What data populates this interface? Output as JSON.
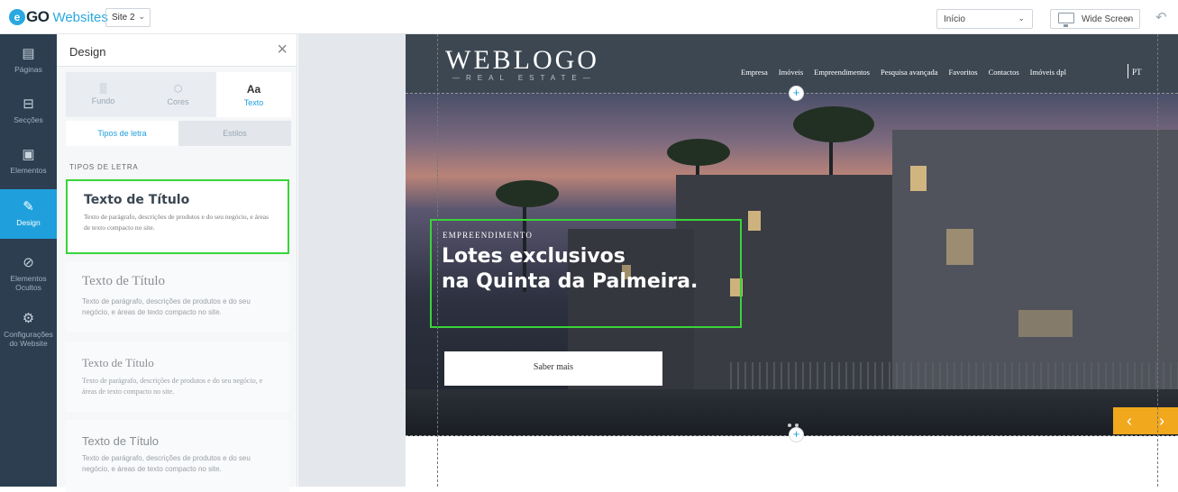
{
  "topbar": {
    "logo_mark": "e",
    "logo_go": "GO",
    "logo_web": "Websites",
    "site_value": "Site 2",
    "page_value": "Início",
    "screen_value": "Wide Screen"
  },
  "leftnav": {
    "items": [
      {
        "label": "Páginas",
        "icon": "pages-icon"
      },
      {
        "label": "Secções",
        "icon": "sections-icon"
      },
      {
        "label": "Elementos",
        "icon": "elements-icon"
      },
      {
        "label": "Design",
        "icon": "pencil-icon"
      },
      {
        "label": "Elementos Ocultos",
        "icon": "eye-slash-icon"
      },
      {
        "label": "Configurações do Website",
        "icon": "gear-icon"
      }
    ]
  },
  "panel": {
    "title": "Design",
    "tabs": [
      {
        "label": "Fundo",
        "icon": "▒"
      },
      {
        "label": "Cores",
        "icon": "⬡"
      },
      {
        "label": "Texto",
        "icon": "Aa"
      }
    ],
    "subtabs": [
      "Tipos de letra",
      "Estilos"
    ],
    "section_label": "TIPOS DE LETRA",
    "cards": [
      {
        "title": "Texto de Título",
        "body": "Texto de parágrafo, descrições de produtos e do seu negócio, e áreas de texto compacto no site."
      },
      {
        "title": "Texto de Título",
        "body": "Texto de parágrafo, descrições de produtos e do seu negócio, e áreas de texto compacto no site."
      },
      {
        "title": "Texto de Título",
        "body": "Texto de parágrafo, descrições de produtos e do seu negócio, e áreas de texto compacto no site."
      },
      {
        "title": "Texto de Título",
        "body": "Texto de parágrafo, descrições de produtos e do seu negócio, e áreas de texto compacto no site."
      }
    ]
  },
  "site": {
    "logo": "WEBLOGO",
    "logo_sub": "—REAL ESTATE—",
    "menu": [
      "Empresa",
      "Imóveis",
      "Empreendimentos",
      "Pesquisa avançada",
      "Favoritos",
      "Contactos",
      "Imóveis dpl"
    ],
    "lang": "PT",
    "hero_kicker": "EMPREENDIMENTO",
    "hero_title_1": "Lotes exclusivos",
    "hero_title_2": "na Quinta da Palmeira.",
    "hero_button": "Saber mais",
    "arrow_prev": "‹",
    "arrow_next": "›"
  },
  "colors": {
    "accent": "#1fa0dc",
    "sidebar": "#2c3e50",
    "selection": "#39d439",
    "slider_arrows": "#f2a81d"
  }
}
